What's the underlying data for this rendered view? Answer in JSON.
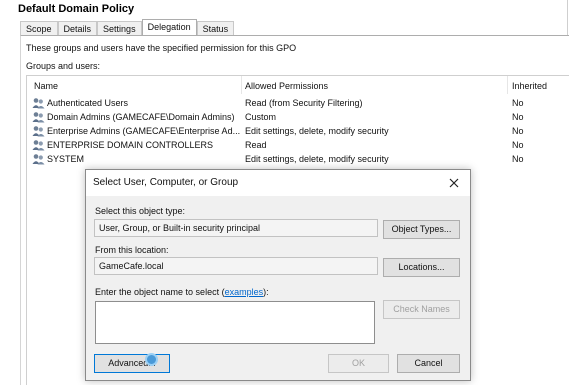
{
  "window": {
    "title": "Default Domain Policy"
  },
  "tabs": [
    {
      "label": "Scope"
    },
    {
      "label": "Details"
    },
    {
      "label": "Settings"
    },
    {
      "label": "Delegation"
    },
    {
      "label": "Status"
    }
  ],
  "active_tab": "Delegation",
  "delegation": {
    "description": "These groups and users have the specified permission for this GPO",
    "groups_label": "Groups and users:",
    "columns": {
      "name": "Name",
      "permissions": "Allowed Permissions",
      "inherited": "Inherited"
    },
    "rows": [
      {
        "name": "Authenticated Users",
        "permissions": "Read (from Security Filtering)",
        "inherited": "No",
        "icon": "users-group-icon"
      },
      {
        "name": "Domain Admins (GAMECAFE\\Domain Admins)",
        "permissions": "Custom",
        "inherited": "No",
        "icon": "users-group-icon"
      },
      {
        "name": "Enterprise Admins (GAMECAFE\\Enterprise Ad...",
        "permissions": "Edit settings, delete, modify security",
        "inherited": "No",
        "icon": "users-group-icon"
      },
      {
        "name": "ENTERPRISE DOMAIN CONTROLLERS",
        "permissions": "Read",
        "inherited": "No",
        "icon": "users-group-icon"
      },
      {
        "name": "SYSTEM",
        "permissions": "Edit settings, delete, modify security",
        "inherited": "No",
        "icon": "users-group-icon"
      }
    ]
  },
  "dialog": {
    "title": "Select User, Computer, or Group",
    "object_type_label": "Select this object type:",
    "object_type_value": "User, Group, or Built-in security principal",
    "object_types_button": "Object Types...",
    "location_label": "From this location:",
    "location_value": "GameCafe.local",
    "locations_button": "Locations...",
    "enter_label_prefix": "Enter the object name to select (",
    "enter_label_link": "examples",
    "enter_label_suffix": "):",
    "check_names_button": "Check Names",
    "advanced_button": "Advanced...",
    "ok_button": "OK",
    "cancel_button": "Cancel"
  },
  "colors": {
    "link": "#0066cc",
    "accent_border": "#0078d7",
    "dialog_bg": "#f0f0f0"
  }
}
